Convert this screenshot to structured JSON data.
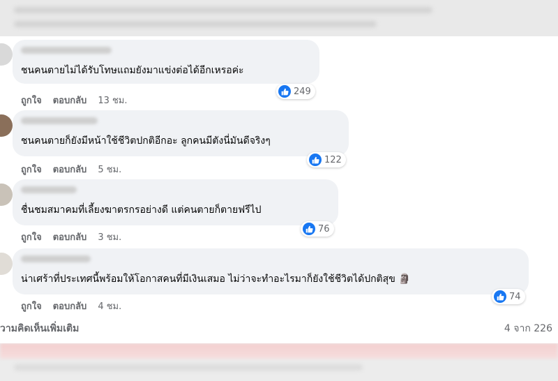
{
  "comments": [
    {
      "text": "ชนคนตายไม่ได้รับโทษแถมยังมาแข่งต่อได้อีกเหรอค่ะ",
      "likes": "249",
      "like_label": "ถูกใจ",
      "reply_label": "ตอบกลับ",
      "time": "13 ชม."
    },
    {
      "text": "ชนคนตายก็ยังมีหน้าใช้ชีวิตปกติอีกอะ ลูกคนมีตังนี่มันดีจริงๆ",
      "likes": "122",
      "like_label": "ถูกใจ",
      "reply_label": "ตอบกลับ",
      "time": "5 ชม."
    },
    {
      "text": "ชื่นชมสมาคมที่เลี้ยงฆาตรกรอย่างดี แต่คนตายก็ตายฟรีไป",
      "likes": "76",
      "like_label": "ถูกใจ",
      "reply_label": "ตอบกลับ",
      "time": "3 ชม."
    },
    {
      "text": "น่าเศร้าที่ประเทศนี้พร้อมให้โอกาสคนที่มีเงินเสมอ ไม่ว่าจะทำอะไรมาก็ยังใช้ชีวิตได้ปกติสุข 🗿",
      "likes": "74",
      "like_label": "ถูกใจ",
      "reply_label": "ตอบกลับ",
      "time": "4 ชม."
    }
  ],
  "footer": {
    "more_comments": "วามคิดเห็นเพิ่มเติม",
    "count": "4 จาก 226"
  },
  "icons": {
    "reaction": "like-icon",
    "accent": "#1877f2"
  }
}
